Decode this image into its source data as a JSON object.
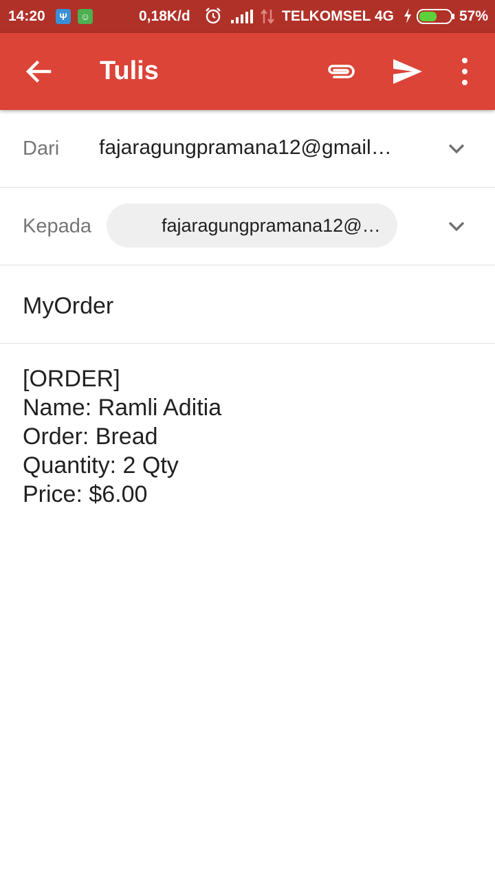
{
  "status_bar": {
    "time": "14:20",
    "speed": "0,18K/d",
    "carrier": "TELKOMSEL 4G",
    "battery": "57%",
    "battery_level": 0.57,
    "icons": [
      "usb-icon",
      "android-icon",
      "alarm-icon",
      "signal-icon",
      "data-icon",
      "charging-icon",
      "battery-icon"
    ]
  },
  "app_bar": {
    "title": "Tulis",
    "color": "#db4437",
    "icons": [
      "back-arrow-icon",
      "attach-icon",
      "send-icon",
      "more-vert-icon"
    ]
  },
  "compose": {
    "from_label": "Dari",
    "from_value": "fajaragungpramana12@gmail…",
    "to_label": "Kepada",
    "to_chip": "fajaragungpramana12@…",
    "subject": "MyOrder",
    "body_lines": [
      "[ORDER]",
      "Name: Ramli Aditia",
      "Order: Bread",
      "Quantity: 2 Qty",
      "Price: $6.00"
    ]
  }
}
